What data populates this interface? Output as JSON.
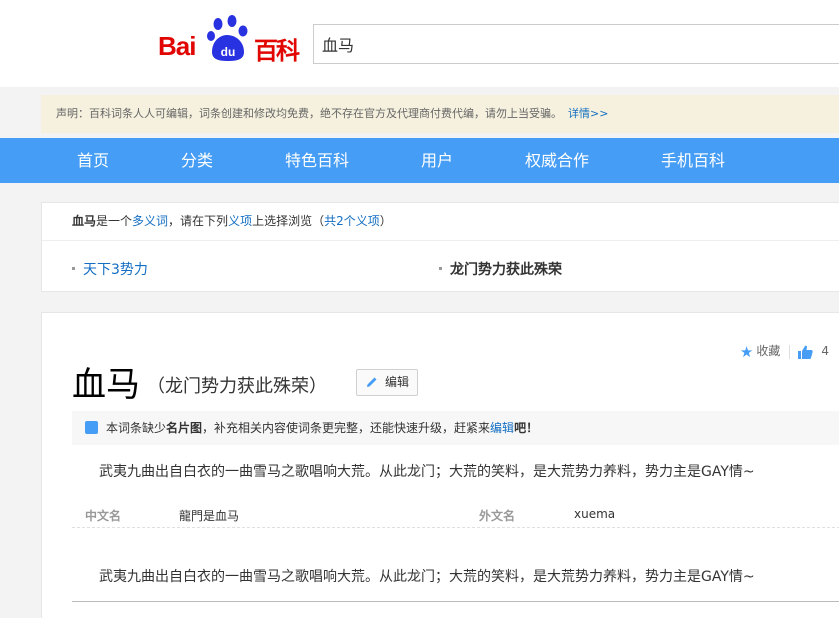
{
  "header": {
    "logo": {
      "part1": "Bai",
      "paw_text": "du",
      "part2": "百科"
    },
    "search": {
      "value": "血马"
    }
  },
  "notice": {
    "text": "声明：百科词条人人可编辑，词条创建和修改均免费，绝不存在官方及代理商付费代编，请勿上当受骗。",
    "link": "详情>>"
  },
  "nav": {
    "items": [
      "首页",
      "分类",
      "特色百科",
      "用户",
      "权威合作",
      "手机百科"
    ]
  },
  "polysemy": {
    "word": "血马",
    "t1": "是一个",
    "link1": "多义词",
    "t2": "，请在下列",
    "link2": "义项",
    "t3": "上选择浏览（",
    "link3": "共2个义项",
    "t4": "）",
    "items": [
      "天下3势力",
      "龙门势力获此殊荣"
    ]
  },
  "entry": {
    "title": "血马",
    "subtitle": "（龙门势力获此殊荣）",
    "edit_label": "编辑",
    "collect_label": "收藏",
    "like_count": "4",
    "tip": {
      "t1": "本词条缺少",
      "bold": "名片图",
      "t2": "，补充相关内容使词条更完整，还能快速升级，赶紧来",
      "link": "编辑",
      "t3": "吧！"
    },
    "summary": "武夷九曲出自白衣的一曲雪马之歌唱响大荒。从此龙门；大荒的笑料，是大荒势力养料，势力主是GAY情~",
    "info": [
      {
        "label": "中文名",
        "value": "龍門是血马"
      },
      {
        "label": "外文名",
        "value": "xuema"
      }
    ],
    "summary2": "武夷九曲出自白衣的一曲雪马之歌唱响大荒。从此龙门；大荒的笑料，是大荒势力养料，势力主是GAY情~"
  },
  "colors": {
    "nav_bg": "#459df5",
    "logo_red": "#e10602",
    "logo_blue": "#2932e1",
    "link": "#136ec2",
    "notice_bg": "#f5f1de"
  }
}
